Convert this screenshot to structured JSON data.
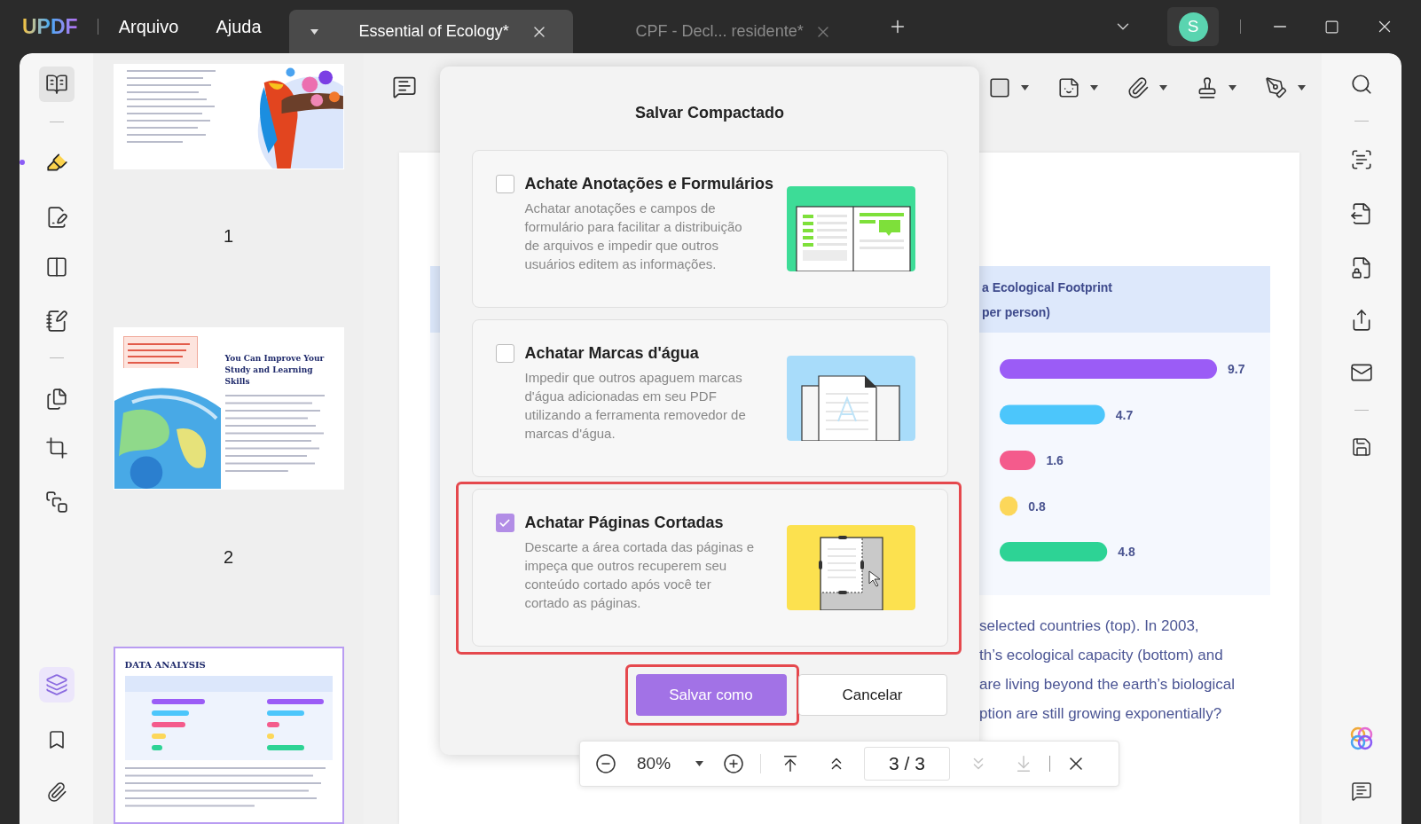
{
  "app": {
    "logo": "UPDF",
    "menus": [
      "Arquivo",
      "Ajuda"
    ]
  },
  "tabs": [
    {
      "title": "Essential of Ecology*",
      "selected": true
    },
    {
      "title": "CPF - Decl... residente*",
      "selected": false
    }
  ],
  "account": {
    "initial": "S"
  },
  "left_rail": {
    "tools": [
      {
        "selected": false,
        "hovered": true
      },
      {
        "selected": true,
        "hovered": false
      },
      {
        "selected": false,
        "hovered": false
      },
      {
        "selected": false,
        "hovered": false
      },
      {
        "selected": false,
        "hovered": false
      },
      {
        "selected": false,
        "hovered": false
      },
      {
        "selected": false,
        "hovered": false
      },
      {
        "selected": false,
        "hovered": false
      }
    ]
  },
  "thumbnails": [
    {
      "kind": "cover",
      "page_label": "1",
      "selected": false
    },
    {
      "kind": "article",
      "heading": "You Can Improve Your Study and Learning Skills",
      "page_label": "2",
      "selected": false
    },
    {
      "kind": "chart",
      "heading": "DATA ANALYSIS",
      "selected": true
    }
  ],
  "document": {
    "chart_header": [
      "a Ecological Footprint",
      "per person)"
    ],
    "chart_data": {
      "type": "bar",
      "orientation": "horizontal",
      "values": [
        9.7,
        4.7,
        1.6,
        0.8,
        4.8
      ],
      "colors": [
        "#9b5cf6",
        "#4cc6fb",
        "#f45b8c",
        "#fcd75a",
        "#2dd395"
      ],
      "data_labels": true
    },
    "paragraph_lines": [
      "selected countries (top). In 2003,",
      "th’s ecological capacity (bottom) and",
      "are living beyond the earth’s biological",
      "ption are still growing exponentially?"
    ]
  },
  "zoom_bar": {
    "zoom": "80%",
    "page_indicator": "3 / 3",
    "nav": [
      {
        "disabled": false
      },
      {
        "disabled": false
      },
      {
        "disabled": true
      },
      {
        "disabled": true
      }
    ]
  },
  "dialog": {
    "title": "Salvar Compactado",
    "options": [
      {
        "kind": "forms",
        "title": "Achate Anotações e Formulários",
        "description": "Achatar anotações e campos de formulário para facilitar a distribuição de arquivos e impedir que outros usuários editem as informações.",
        "checked": false,
        "highlighted": false
      },
      {
        "kind": "watermark",
        "title": "Achatar Marcas d'água",
        "description": "Impedir que outros apaguem marcas d'água adicionadas em seu PDF utilizando a ferramenta removedor de marcas d'água.",
        "checked": false,
        "highlighted": false
      },
      {
        "kind": "crop",
        "title": "Achatar Páginas Cortadas",
        "description": "Descarte a área cortada das páginas e impeça que outros recuperem seu conteúdo cortado após você ter cortado as páginas.",
        "checked": true,
        "highlighted": true
      }
    ],
    "buttons": [
      {
        "kind": "primary",
        "label": "Salvar como",
        "highlighted": true
      },
      {
        "kind": "secondary",
        "label": "Cancelar",
        "highlighted": false
      }
    ]
  }
}
